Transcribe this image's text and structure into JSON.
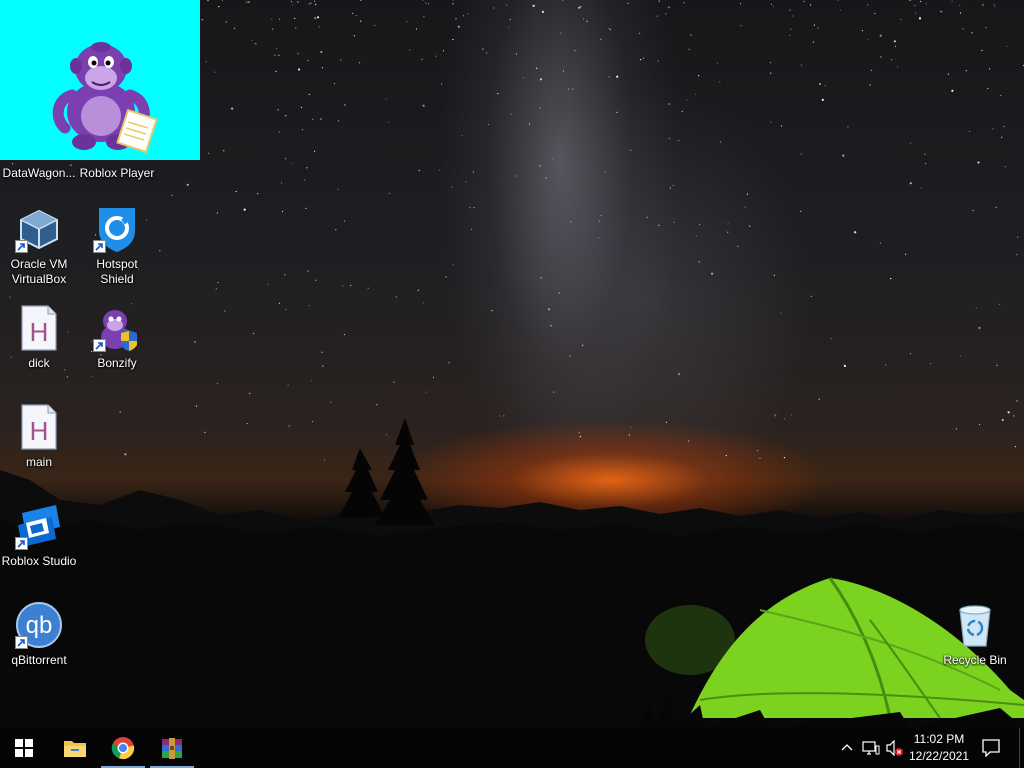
{
  "desktop": {
    "icons": [
      {
        "label": "DataWagon..."
      },
      {
        "label": "Roblox Player"
      },
      {
        "label": "Oracle VM\nVirtualBox"
      },
      {
        "label": "Hotspot\nShield"
      },
      {
        "label": "dick"
      },
      {
        "label": "Bonzify"
      },
      {
        "label": "main"
      },
      {
        "label": "Roblox Studio"
      },
      {
        "label": "qBittorrent"
      },
      {
        "label": "Recycle Bin"
      }
    ]
  },
  "taskbar": {
    "clock": {
      "time": "11:02 PM",
      "date": "12/22/2021"
    },
    "pinned": [
      {
        "name": "start-icon"
      },
      {
        "name": "file-explorer-icon"
      },
      {
        "name": "chrome-icon"
      },
      {
        "name": "winrar-icon"
      }
    ]
  },
  "colors": {
    "bonzi_window_bg": "#00ffff",
    "taskbar_bg": "#050505",
    "tent": "#7bd320"
  }
}
